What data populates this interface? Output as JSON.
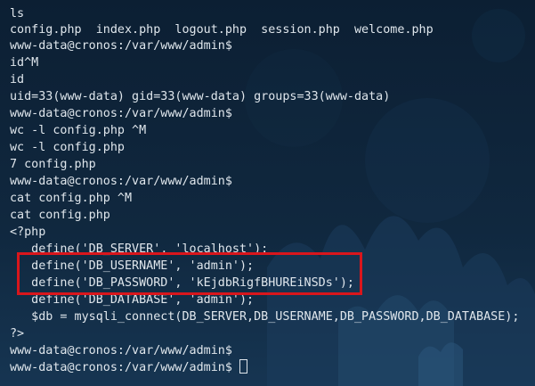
{
  "terminal": {
    "lines": [
      "ls",
      "config.php  index.php  logout.php  session.php  welcome.php",
      "www-data@cronos:/var/www/admin$",
      "id^M",
      "id",
      "uid=33(www-data) gid=33(www-data) groups=33(www-data)",
      "www-data@cronos:/var/www/admin$",
      "wc -l config.php ^M",
      "wc -l config.php",
      "7 config.php",
      "www-data@cronos:/var/www/admin$",
      "cat config.php ^M",
      "cat config.php",
      "<?php",
      "   define('DB_SERVER', 'localhost');",
      "   define('DB_USERNAME', 'admin');",
      "   define('DB_PASSWORD', 'kEjdbRigfBHUREiNSDs');",
      "   define('DB_DATABASE', 'admin');",
      "   $db = mysqli_connect(DB_SERVER,DB_USERNAME,DB_PASSWORD,DB_DATABASE);",
      "?>",
      "www-data@cronos:/var/www/admin$",
      "www-data@cronos:/var/www/admin$ "
    ]
  },
  "colors": {
    "background": "#0e2236",
    "text": "#dfe6ec",
    "highlight": "#d9161c"
  }
}
